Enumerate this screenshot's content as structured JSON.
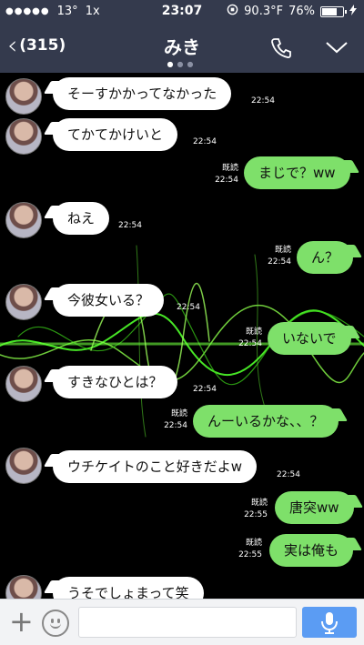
{
  "status_bar": {
    "signal": "●●●●●",
    "temperature": "13°",
    "zoom": "1x",
    "time": "23:07",
    "weather": "90.3°F",
    "battery": "76%",
    "battery_level": 0.76
  },
  "header": {
    "back_count": "(315)",
    "title": "みき"
  },
  "messages": [
    {
      "dir": "in",
      "text": "そーすかかってなかった",
      "time": "22:54"
    },
    {
      "dir": "in",
      "text": "てかてかけいと",
      "time": "22:54"
    },
    {
      "dir": "out",
      "text": "まじで？ww",
      "read": "既読",
      "time": "22:54"
    },
    {
      "dir": "in",
      "text": "ねえ",
      "time": "22:54"
    },
    {
      "dir": "out",
      "text": "ん？",
      "read": "既読",
      "time": "22:54"
    },
    {
      "dir": "in",
      "text": "今彼女いる？",
      "time": "22:54"
    },
    {
      "dir": "out",
      "text": "いないで",
      "read": "既読",
      "time": "22:54"
    },
    {
      "dir": "in",
      "text": "すきなひとは？",
      "time": "22:54"
    },
    {
      "dir": "out",
      "text": "んーいるかな、、？",
      "read": "既読",
      "time": "22:54"
    },
    {
      "dir": "in",
      "text": "ウチケイトのこと好きだよw",
      "time": "22:54"
    },
    {
      "dir": "out",
      "text": "唐突ww",
      "read": "既読",
      "time": "22:55"
    },
    {
      "dir": "out",
      "text": "実は俺も",
      "read": "既読",
      "time": "22:55"
    },
    {
      "dir": "in",
      "text": "うそでしょまって笑",
      "time": ""
    }
  ],
  "input_bar": {
    "text_value": ""
  }
}
